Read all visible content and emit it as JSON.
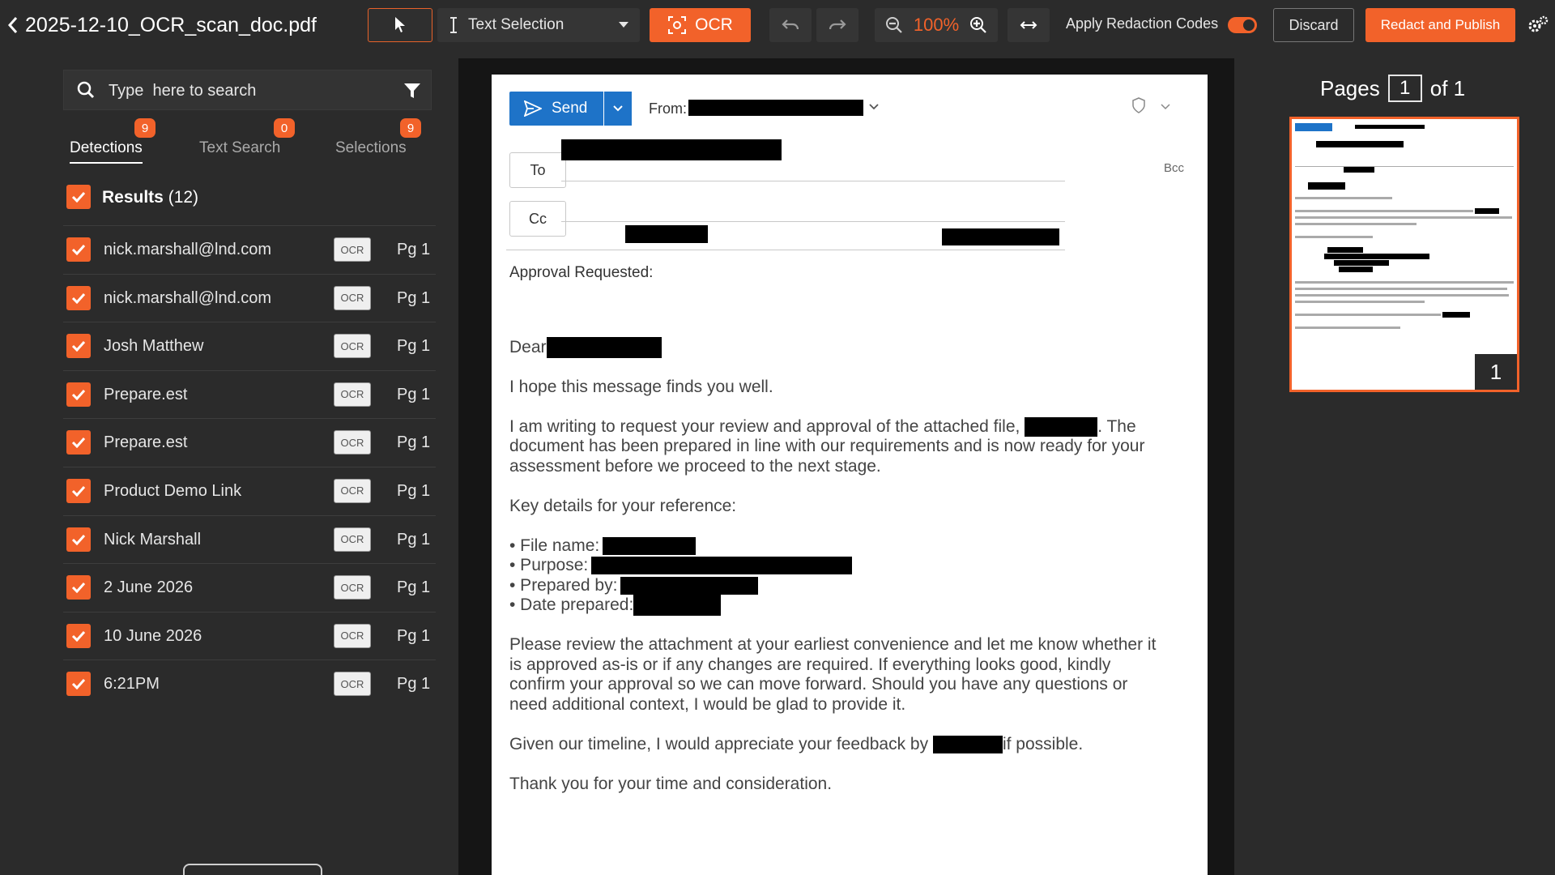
{
  "document": {
    "title": "2025-12-10_OCR_scan_doc.pdf"
  },
  "toolbar": {
    "text_selection_label": "Text Selection",
    "ocr_label": "OCR",
    "zoom": "100%",
    "apply_redaction_label": "Apply Redaction Codes",
    "apply_redaction_enabled": true,
    "discard_label": "Discard",
    "publish_label": "Redact and Publish"
  },
  "search": {
    "placeholder": "Type  here to search"
  },
  "tabs": [
    {
      "label": "Detections",
      "badge": "9",
      "active": true
    },
    {
      "label": "Text Search",
      "badge": "0",
      "active": false
    },
    {
      "label": "Selections",
      "badge": "9",
      "active": false
    }
  ],
  "results": {
    "title": "Results",
    "count": "(12)",
    "items": [
      {
        "text": "nick.marshall@lnd.com",
        "tag": "OCR",
        "page": "Pg 1"
      },
      {
        "text": "nick.marshall@lnd.com",
        "tag": "OCR",
        "page": "Pg 1"
      },
      {
        "text": "Josh Matthew",
        "tag": "OCR",
        "page": "Pg 1"
      },
      {
        "text": "Prepare.est",
        "tag": "OCR",
        "page": "Pg 1"
      },
      {
        "text": "Prepare.est",
        "tag": "OCR",
        "page": "Pg 1"
      },
      {
        "text": "Product Demo Link",
        "tag": "OCR",
        "page": "Pg 1"
      },
      {
        "text": "Nick Marshall",
        "tag": "OCR",
        "page": "Pg 1"
      },
      {
        "text": "2 June 2026",
        "tag": "OCR",
        "page": "Pg 1"
      },
      {
        "text": "10 June 2026",
        "tag": "OCR",
        "page": "Pg 1"
      },
      {
        "text": "6:21PM",
        "tag": "OCR",
        "page": "Pg 1"
      }
    ]
  },
  "email": {
    "send_label": "Send",
    "from_label": "From:",
    "to_label": "To",
    "cc_label": "Cc",
    "bcc_label": "Bcc",
    "approval_label": "Approval Requested:",
    "greeting": "Dear",
    "line_1": "I hope this message finds you well.",
    "p2_a": "I am writing to request your review and approval of the attached file,",
    "p2_b": ". The",
    "p2_line2": "document has been prepared in line with our requirements and is now ready for your",
    "p2_line3": "assessment before we proceed to the next stage.",
    "key_details": "Key details for your reference:",
    "bullet_file": "• File name:",
    "bullet_purpose": "• Purpose:",
    "bullet_prepared_by": "• Prepared by:",
    "bullet_date": "• Date prepared:",
    "p4_l1": "Please review the attachment at your earliest convenience and let me know whether it",
    "p4_l2": "is approved as-is or if any changes are required. If everything looks good, kindly",
    "p4_l3": "confirm your approval so we can move forward. Should you have any questions or",
    "p4_l4": "need additional context, I would be glad to provide it.",
    "p5_a": "Given our timeline, I would appreciate your feedback by",
    "p5_b": "if possible.",
    "closing": "Thank you for your time and consideration."
  },
  "pages": {
    "label": "Pages",
    "current": "1",
    "of_label": "of 1",
    "thumb_number": "1"
  },
  "colors": {
    "accent": "#f2622a",
    "send_blue": "#1e73c8",
    "panel_bg": "#2b2b2b"
  },
  "icons": [
    "chevron-left-icon",
    "cursor-icon",
    "text-cursor-icon",
    "caret-down-icon",
    "ocr-scan-icon",
    "undo-icon",
    "redo-icon",
    "zoom-out-icon",
    "zoom-in-icon",
    "fit-width-icon",
    "gear-icon",
    "search-icon",
    "filter-icon",
    "checkmark-icon",
    "send-icon",
    "shield-icon"
  ]
}
